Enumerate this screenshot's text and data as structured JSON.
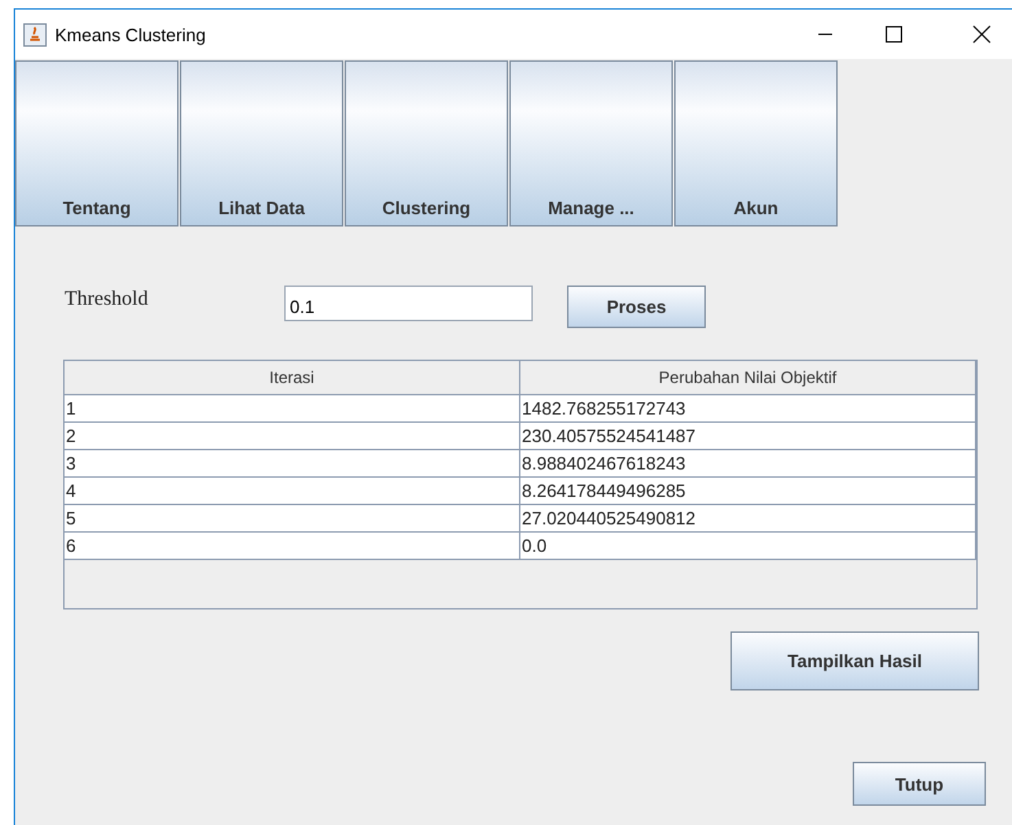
{
  "window": {
    "title": "Kmeans Clustering"
  },
  "nav_buttons": [
    {
      "label": "Tentang"
    },
    {
      "label": "Lihat Data"
    },
    {
      "label": "Clustering"
    },
    {
      "label": "Manage ..."
    },
    {
      "label": "Akun"
    }
  ],
  "threshold": {
    "label": "Threshold",
    "value": "0.1"
  },
  "process_button": "Proses",
  "table": {
    "columns": [
      "Iterasi",
      "Perubahan Nilai Objektif"
    ],
    "rows": [
      [
        "1",
        "1482.768255172743"
      ],
      [
        "2",
        "230.40575524541487"
      ],
      [
        "3",
        "8.988402467618243"
      ],
      [
        "4",
        "8.264178449496285"
      ],
      [
        "5",
        "27.020440525490812"
      ],
      [
        "6",
        "0.0"
      ]
    ]
  },
  "show_results_button": "Tampilkan Hasil",
  "close_button": "Tutup"
}
